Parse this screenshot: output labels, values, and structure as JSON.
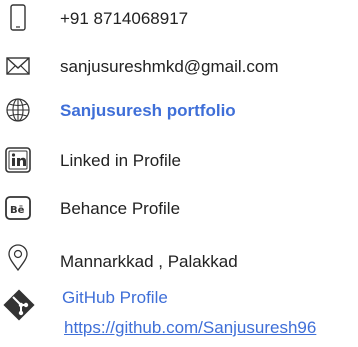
{
  "contacts": {
    "phone": {
      "text": "+91 8714068917",
      "icon": "phone-icon"
    },
    "email": {
      "text": "sanjusureshmkd@gmail.com",
      "icon": "mail-icon"
    },
    "portfolio": {
      "text": "Sanjusuresh portfolio",
      "icon": "globe-icon",
      "color": "#3f6fd8"
    },
    "linkedin": {
      "text": "Linked in Profile",
      "icon": "linkedin-icon"
    },
    "behance": {
      "text": "Behance Profile",
      "icon": "behance-icon"
    },
    "location": {
      "text": "Mannarkkad , Palakkad",
      "icon": "location-pin-icon"
    },
    "github": {
      "title": "GitHub Profile",
      "url": "https://github.com/Sanjusuresh96",
      "icon": "git-icon",
      "color": "#3f6fd8"
    }
  }
}
